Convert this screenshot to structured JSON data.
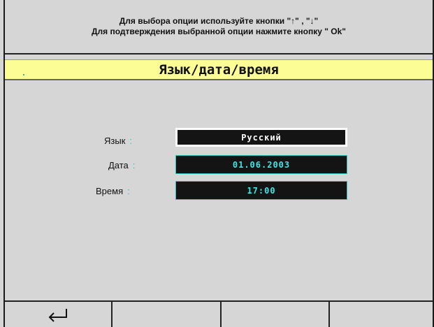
{
  "hint": {
    "line1": "Для выбора опции используйте кнопки \"↑\" , \"↓\"",
    "line2": "Для подтверждения выбранной опции нажмите кнопку \" Ok\""
  },
  "title": "Язык/дата/время",
  "fields": [
    {
      "label": "Язык",
      "value": "Русский",
      "selected": true
    },
    {
      "label": "Дата",
      "value": "01.06.2003",
      "selected": false
    },
    {
      "label": "Время",
      "value": "17:00",
      "selected": false
    }
  ],
  "separator": ":",
  "footer": {
    "keys": [
      {
        "icon": "return-arrow-icon"
      },
      {
        "icon": ""
      },
      {
        "icon": ""
      },
      {
        "icon": ""
      }
    ]
  },
  "colors": {
    "background": "#d6d6d6",
    "title_bar": "#fdfd96",
    "field_background": "#141414",
    "field_text": "#3ee6e6",
    "selected_text": "#ffffff",
    "colon_accent": "#22c8c8"
  }
}
